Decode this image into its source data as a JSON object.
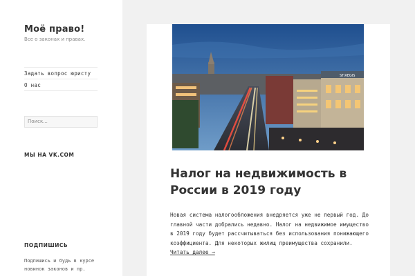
{
  "site": {
    "title": "Моё право!",
    "description": "Все о законах и правах."
  },
  "menu": {
    "items": [
      {
        "label": "Задать вопрос юристу"
      },
      {
        "label": "О нас"
      }
    ]
  },
  "search": {
    "placeholder": "Поиск..."
  },
  "widgets": {
    "vk_title": "МЫ НА VK.COM",
    "subscribe_title": "ПОДПИШИСЬ",
    "subscribe_text": "Подпишись и будь в курсе новинок законов и пр."
  },
  "post": {
    "title": "Налог на недвижимость в России в 2019 году",
    "excerpt": "Новая система налогообложения внедряется уже не первый год. До главной части добрались недавно. Налог на недвижимое имущество в 2019 году будет рассчитываться без использования понижающего коэффициента. Для некоторых жилищ преимущества сохранили.",
    "read_more": "Читать далее →",
    "image_sign": "ST.REGIS"
  },
  "colors": {
    "sky": "#2f5fa0",
    "road": "#3a3f4a",
    "sidebar_bg": "#ffffff",
    "page_bg": "#f1f1f1"
  }
}
